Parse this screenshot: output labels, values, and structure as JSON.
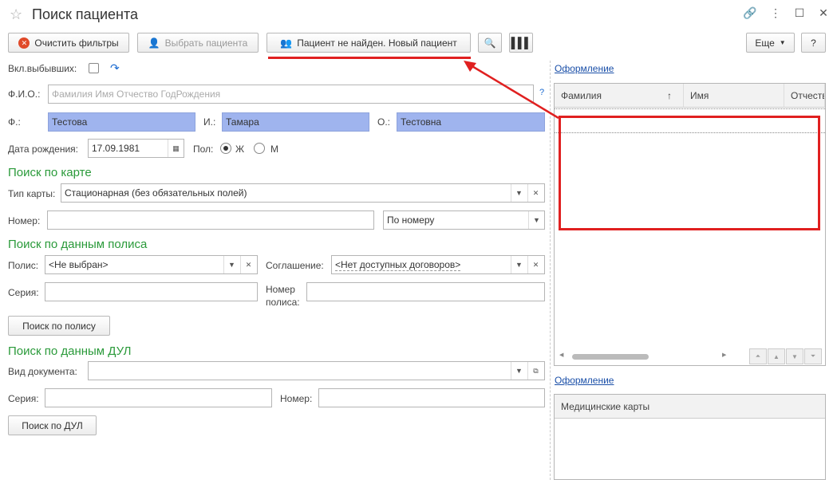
{
  "window": {
    "title": "Поиск пациента"
  },
  "toolbar": {
    "clear_filters": "Очистить фильтры",
    "select_patient": "Выбрать пациента",
    "new_patient": "Пациент не найден. Новый пациент",
    "more": "Еще",
    "help": "?"
  },
  "form": {
    "include_retired_label": "Вкл.выбывших:",
    "fio_label": "Ф.И.О.:",
    "fio_placeholder": "Фамилия Имя Отчество ГодРождения",
    "fio_help": "?",
    "last_name_label": "Ф.:",
    "last_name_value": "Тестова",
    "first_name_label": "И.:",
    "first_name_value": "Тамара",
    "middle_name_label": "О.:",
    "middle_name_value": "Тестовна",
    "birth_label": "Дата рождения:",
    "birth_value": "17.09.1981",
    "gender_label": "Пол:",
    "gender_f": "Ж",
    "gender_m": "М",
    "gender_selected": "Ж"
  },
  "card_section": {
    "title": "Поиск по  карте",
    "type_label": "Тип карты:",
    "type_value": "Стационарная (без обязательных полей)",
    "number_label": "Номер:",
    "number_value": "",
    "search_mode_value": "По номеру"
  },
  "policy_section": {
    "title": "Поиск по данным полиса",
    "policy_label": "Полис:",
    "policy_value": "<Не выбран>",
    "agreement_label": "Соглашение:",
    "agreement_value": "<Нет доступных договоров>",
    "series_label": "Серия:",
    "policy_number_label_1": "Номер",
    "policy_number_label_2": "полиса:",
    "search_button": "Поиск по полису"
  },
  "dul_section": {
    "title": "Поиск по данным ДУЛ",
    "doc_type_label": "Вид документа:",
    "series_label": "Серия:",
    "number_label": "Номер:",
    "search_button": "Поиск по ДУЛ"
  },
  "right_panel": {
    "design_link_1": "Оформление",
    "columns": [
      "Фамилия",
      "Имя",
      "Отчество"
    ],
    "sort_indicator": "↑",
    "design_link_2": "Оформление",
    "med_cards_header": "Медицинские карты"
  },
  "colors": {
    "accent_green": "#2a9a3a",
    "highlight_red": "#e02020",
    "field_blue": "#9fb4ee",
    "link_blue": "#1a4fa8"
  }
}
